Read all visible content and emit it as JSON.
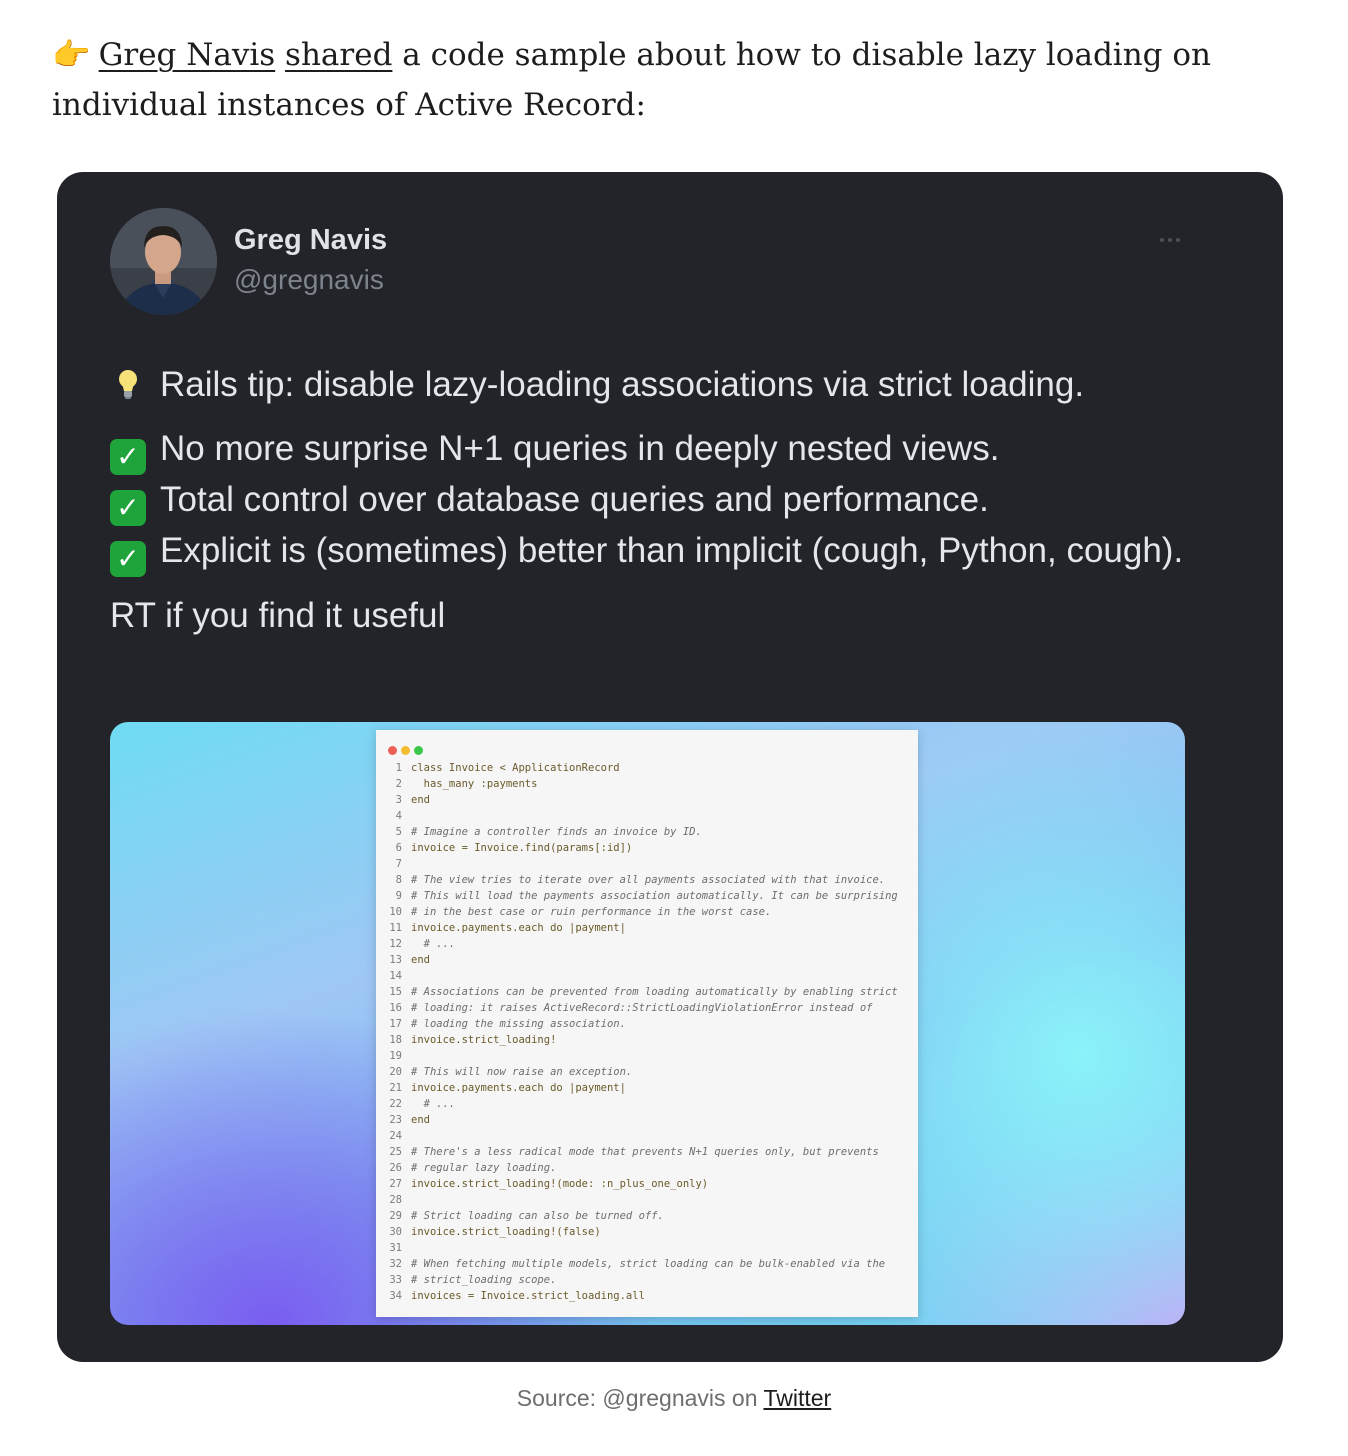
{
  "intro": {
    "emoji": "👉",
    "author_link": "Greg Navis",
    "shared_link": "shared",
    "text": " a code sample about how to disable lazy loading on individual instances of Active Record:"
  },
  "tweet": {
    "author_name": "Greg Navis",
    "author_handle": "@gregnavis",
    "line1": "Rails tip: disable lazy-loading associations via strict loading.",
    "check1": "No more surprise N+1 queries in deeply nested views.",
    "check2": "Total control over database queries and performance.",
    "check3": "Explicit is (sometimes) better than implicit (cough, Python, cough).",
    "rt": "RT if you find it useful",
    "icons": {
      "bulb": "lightbulb-icon",
      "check": "check-mark-icon",
      "more": "more-options-icon"
    }
  },
  "code_lines": [
    "class Invoice < ApplicationRecord",
    "  has_many :payments",
    "end",
    "",
    "# Imagine a controller finds an invoice by ID.",
    "invoice = Invoice.find(params[:id])",
    "",
    "# The view tries to iterate over all payments associated with that invoice.",
    "# This will load the payments association automatically. It can be surprising",
    "# in the best case or ruin performance in the worst case.",
    "invoice.payments.each do |payment|",
    "  # ...",
    "end",
    "",
    "# Associations can be prevented from loading automatically by enabling strict",
    "# loading: it raises ActiveRecord::StrictLoadingViolationError instead of",
    "# loading the missing association.",
    "invoice.strict_loading!",
    "",
    "# This will now raise an exception.",
    "invoice.payments.each do |payment|",
    "  # ...",
    "end",
    "",
    "# There's a less radical mode that prevents N+1 queries only, but prevents",
    "# regular lazy loading.",
    "invoice.strict_loading!(mode: :n_plus_one_only)",
    "",
    "# Strict loading can also be turned off.",
    "invoice.strict_loading!(false)",
    "",
    "# When fetching multiple models, strict loading can be bulk-enabled via the",
    "# strict_loading scope.",
    "invoices = Invoice.strict_loading.all"
  ],
  "caption": {
    "prefix": "Source: @gregnavis on ",
    "link": "Twitter"
  },
  "colors": {
    "tweet_bg": "#222429",
    "check_green": "#1ea43a",
    "dot_red": "#ec5f57",
    "dot_yellow": "#f3bd2e",
    "dot_green": "#3bc74a"
  }
}
